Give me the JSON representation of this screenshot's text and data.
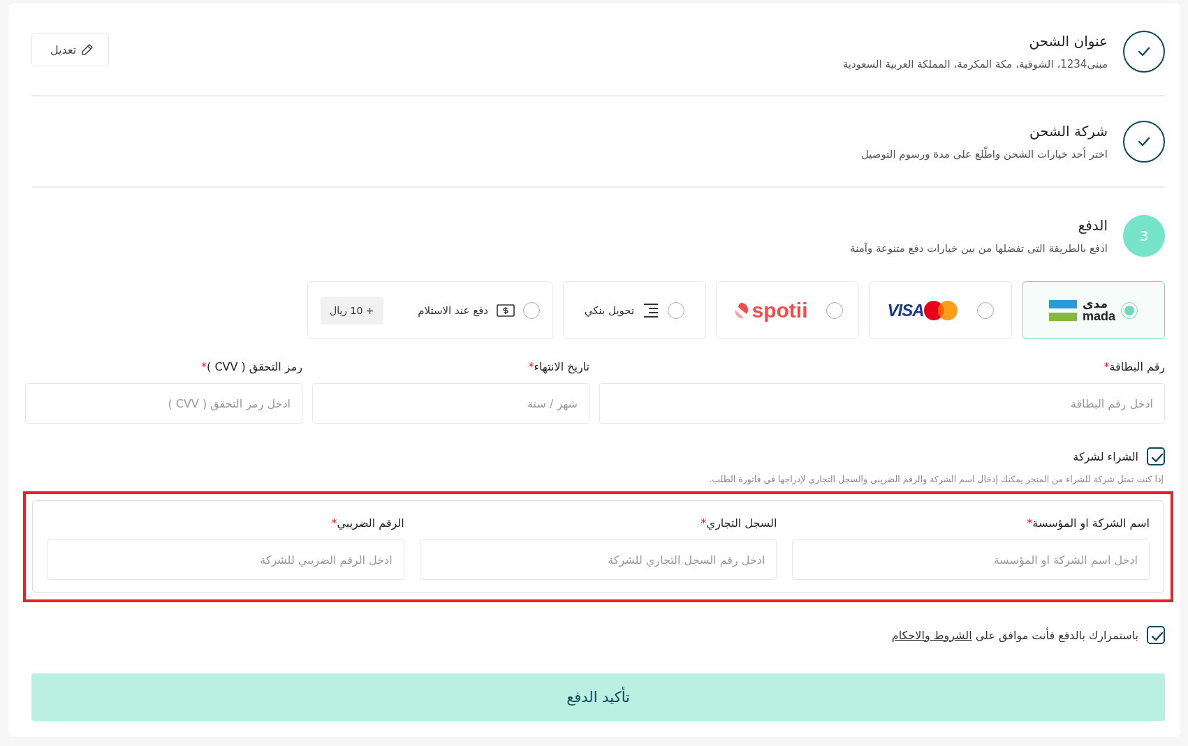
{
  "steps": [
    {
      "kind": "done",
      "title": "عنوان الشحن",
      "subtitle": "مبنى1234، الشوقية، مكة المكرمة، المملكة العربية السعودية",
      "action": "تعديل"
    },
    {
      "kind": "done",
      "title": "شركة الشحن",
      "subtitle": "اختر أحد خيارات الشحن واطّلع على مدة ورسوم التوصيل"
    },
    {
      "kind": "current",
      "number": "3",
      "title": "الدفع",
      "subtitle": "ادفع بالطريقة التى تفضلها من بين خيارات دفع متنوعة وآمنة"
    }
  ],
  "payment_methods": [
    {
      "kind": "mada",
      "selected": true,
      "logo_ar": "مدى",
      "logo_en": "mada"
    },
    {
      "kind": "visa",
      "selected": false,
      "logo": "VISA"
    },
    {
      "kind": "spotii",
      "selected": false,
      "logo": "spotii"
    },
    {
      "kind": "bank",
      "selected": false,
      "label": "تحويل بنكي"
    },
    {
      "kind": "cod",
      "selected": false,
      "label": "دفع عند الاستلام",
      "fee": "+ 10 ريال"
    }
  ],
  "card_fields": [
    {
      "label": "رقم البطاقة",
      "required_mark": "*",
      "placeholder": "ادخل رقم البطاقة"
    },
    {
      "label": "تاريخ الانتهاء",
      "required_mark": "*",
      "placeholder": "شهر / سنة"
    },
    {
      "label": "رمز التحقق ( CVV )",
      "required_mark": "*",
      "placeholder": "ادخل رمز التحقق ( CVV )"
    }
  ],
  "company": {
    "label": "الشراء لشركة",
    "checked": true,
    "hint": "إذا كنت تمثل شركة للشراء من المتجر يمكنك إدخال اسم الشركة والرقم الضريبي والسجل التجاري لإدراجها في فاتورة الطلب.",
    "highlighted": true,
    "fields": [
      {
        "label": "اسم الشركة او المؤسسة",
        "required_mark": "*",
        "placeholder": "ادخل اسم الشركة او المؤسسة"
      },
      {
        "label": "السجل التجاري",
        "required_mark": "*",
        "placeholder": "ادخل رقم السجل التجاري للشركة"
      },
      {
        "label": "الرقم الضريبي",
        "required_mark": "*",
        "placeholder": "ادخل الرقم الضريبي للشركة"
      }
    ]
  },
  "terms": {
    "checked": true,
    "text": "باستمرارك بالدفع فأنت موافق على",
    "link": "الشروط والاحكام"
  },
  "submit": "تأكيد الدفع"
}
